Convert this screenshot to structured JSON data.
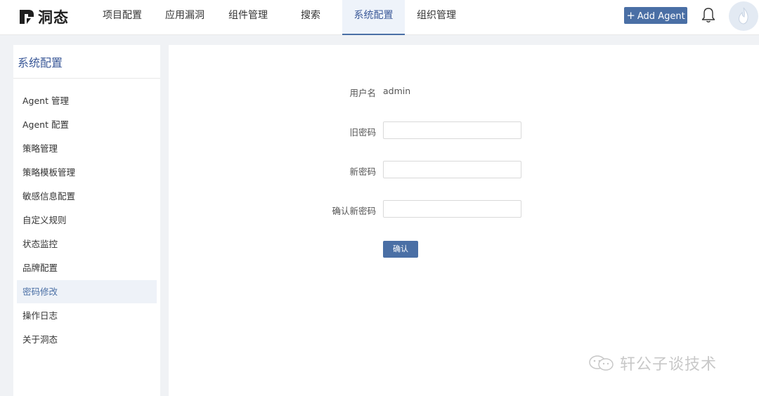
{
  "brand": {
    "name": "洞态"
  },
  "nav": {
    "items": [
      "项目配置",
      "应用漏洞",
      "组件管理",
      "搜索",
      "系统配置",
      "组织管理"
    ],
    "active_index": 4,
    "add_agent_label": "Add Agent",
    "icons": [
      "plus-icon",
      "bell-icon",
      "avatar-icon"
    ]
  },
  "sidebar": {
    "title": "系统配置",
    "items": [
      {
        "label": "Agent 管理"
      },
      {
        "label": "Agent 配置"
      },
      {
        "label": "策略管理"
      },
      {
        "label": "策略模板管理"
      },
      {
        "label": "敏感信息配置"
      },
      {
        "label": "自定义规则"
      },
      {
        "label": "状态监控"
      },
      {
        "label": "品牌配置"
      },
      {
        "label": "密码修改"
      },
      {
        "label": "操作日志"
      },
      {
        "label": "关于洞态"
      }
    ],
    "active_index": 8
  },
  "form": {
    "username_label": "用户名",
    "username_value": "admin",
    "old_password_label": "旧密码",
    "old_password_value": "",
    "new_password_label": "新密码",
    "new_password_value": "",
    "confirm_password_label": "确认新密码",
    "confirm_password_value": "",
    "submit_label": "确认"
  },
  "watermark": {
    "text": "轩公子谈技术",
    "icon": "wechat-icon"
  },
  "colors": {
    "accent": "#4a6fa5",
    "active_bg": "#eef3fa",
    "page_bg": "#f0f2f5"
  }
}
